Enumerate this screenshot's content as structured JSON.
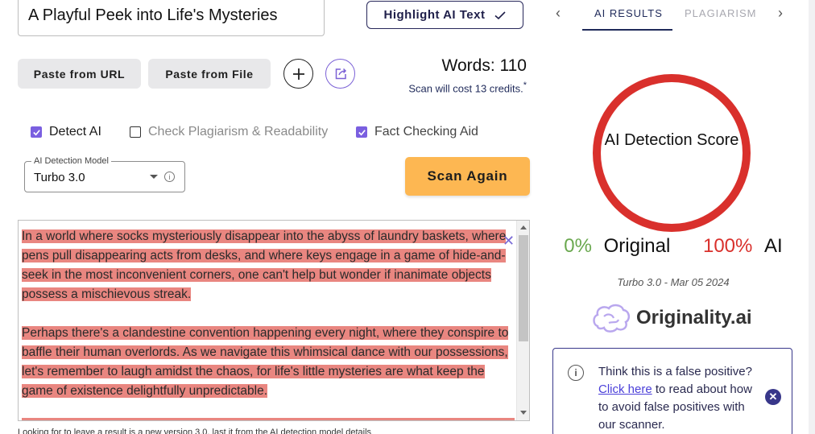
{
  "document": {
    "title": "A Playful Peek into Life's Mysteries"
  },
  "toolbar": {
    "highlight_label": "Highlight AI Text",
    "paste_url_label": "Paste from URL",
    "paste_file_label": "Paste from File",
    "add_icon": "plus-icon",
    "share_icon": "share-icon"
  },
  "stats": {
    "words": "Words: 110",
    "cost": "Scan will cost 13 credits.",
    "cost_mark": "*"
  },
  "options": {
    "detect_ai": {
      "label": "Detect AI",
      "checked": true
    },
    "check_plagiarism": {
      "label": "Check Plagiarism & Readability",
      "checked": false
    },
    "fact_checking": {
      "label": "Fact Checking Aid",
      "checked": true
    }
  },
  "model_select": {
    "label": "AI Detection Model",
    "value": "Turbo 3.0"
  },
  "scan_button_label": "Scan Again",
  "editor": {
    "paragraphs": [
      "In a world where socks mysteriously disappear into the abyss of laundry baskets, where pens pull disappearing acts from desks, and where keys engage in a game of hide-and-seek in the most inconvenient corners, one can't help but wonder if inanimate objects possess a mischievous streak.",
      "Perhaps there's a clandestine convention happening every night, where they conspire to baffle their human overlords. As we navigate this whimsical dance with our possessions, let's remember to laugh amidst the chaos, for life's little mysteries are what keep the game of existence delightfully unpredictable."
    ],
    "close_glyph": "✕"
  },
  "footnote": "Looking for to leave a result is a new version 3.0, last it from the AI detection model details",
  "results": {
    "tabs": [
      "AI RESULTS",
      "PLAGIARISM"
    ],
    "active_tab": "AI RESULTS",
    "score_label": "AI Detection Score",
    "original_pct": "0%",
    "original_label": "Original",
    "ai_pct": "100%",
    "ai_label": "AI",
    "model_date": "Turbo 3.0 - Mar 05 2024",
    "brand": "Originality.ai",
    "info": {
      "text_before": "Think this is a false positive?",
      "link": "Click here",
      "text_after": "to read about how to avoid false positives with our scanner."
    }
  },
  "colors": {
    "highlight": "#e98680",
    "ai_red": "#d9302c",
    "original_green": "#6aa84f",
    "scan_orange": "#fdb752",
    "checkbox_purple": "#7a5fe0",
    "navy": "#1f2a5a"
  }
}
